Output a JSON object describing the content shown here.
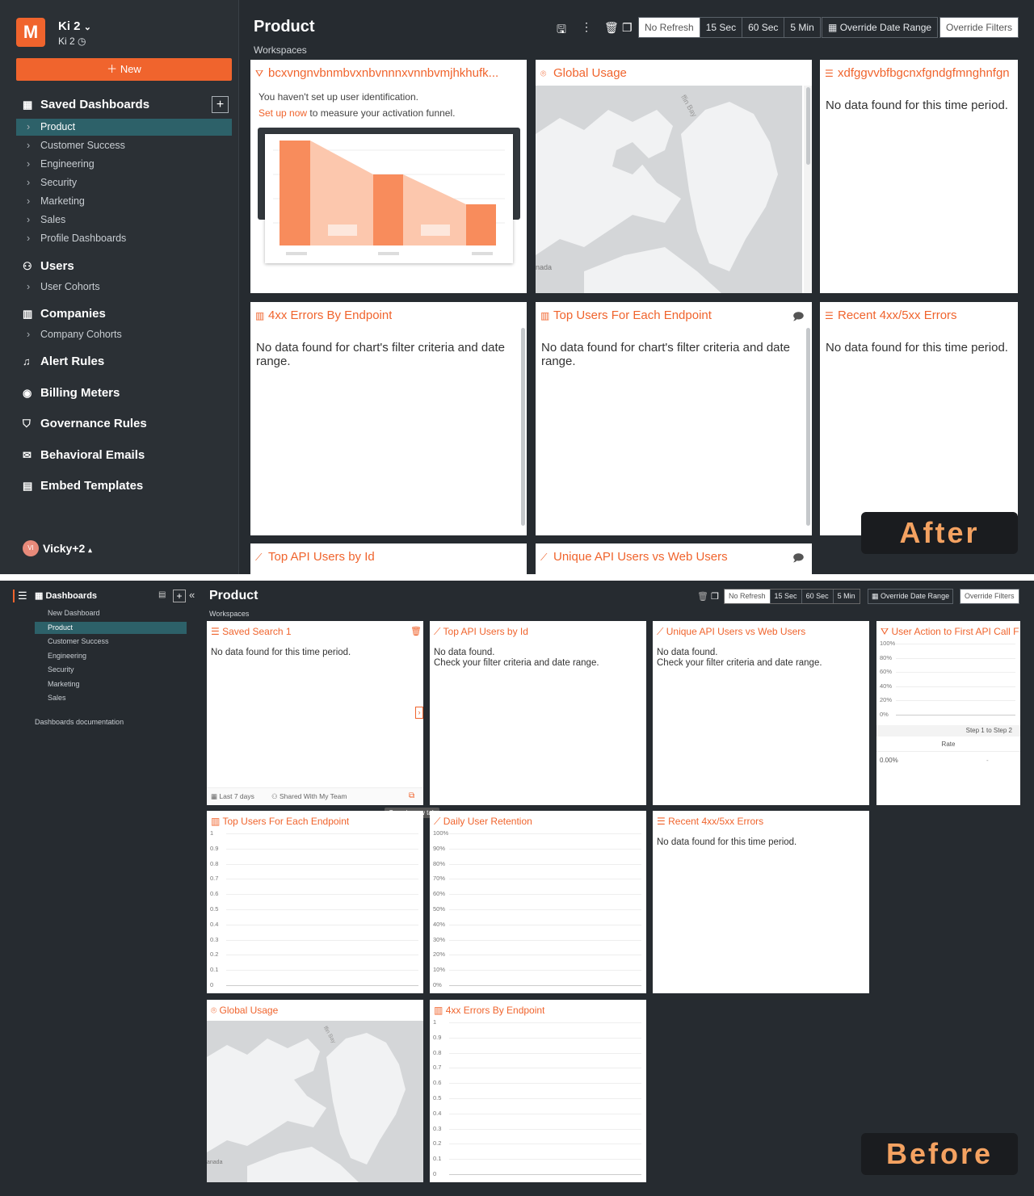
{
  "after": {
    "label": "After",
    "workspace": {
      "name": "Ki 2",
      "sub": "Ki 2"
    },
    "new_button": "New",
    "sections": {
      "saved_dashboards": "Saved Dashboards",
      "users": "Users",
      "companies": "Companies",
      "alert_rules": "Alert Rules",
      "billing_meters": "Billing Meters",
      "governance_rules": "Governance Rules",
      "behavioral_emails": "Behavioral Emails",
      "embed_templates": "Embed Templates"
    },
    "dashboards": [
      "Product",
      "Customer Success",
      "Engineering",
      "Security",
      "Marketing",
      "Sales",
      "Profile Dashboards"
    ],
    "user_items": [
      "User Cohorts"
    ],
    "company_items": [
      "Company Cohorts"
    ],
    "user_menu": {
      "avatar": "VI",
      "name": "Vicky+2"
    },
    "page_title": "Product",
    "breadcrumb": "Workspaces",
    "refresh_options": [
      "No Refresh",
      "15 Sec",
      "60 Sec",
      "5 Min"
    ],
    "override_date": "Override Date Range",
    "override_filters": "Override Filters",
    "cards": {
      "c1_title": "bcxvngnvbnmbvxnbvnnnxvnnbvmjhkhufk...",
      "c1_line1": "You haven't set up user identification.",
      "c1_link": "Set up now",
      "c1_line2": " to measure your activation funnel.",
      "c2_title": "Global Usage",
      "c2_map_label": "nada",
      "c2_bay": "ffin Bay",
      "c3_title": "xdfggvvbfbgcnxfgndgfmnghnfgn",
      "c3_msg": "No data found for this time period.",
      "c4_title": "4xx Errors By Endpoint",
      "c4_msg": "No data found for chart's filter criteria and date range.",
      "c5_title": "Top Users For Each Endpoint",
      "c5_msg": "No data found for chart's filter criteria and date range.",
      "c6_title": "Recent 4xx/5xx Errors",
      "c6_msg": "No data found for this time period.",
      "c7_title": "Top API Users by Id",
      "c8_title": "Unique API Users vs Web Users"
    }
  },
  "before": {
    "label": "Before",
    "sidebar_title": "Dashboards",
    "dashboards": [
      "New Dashboard",
      "Product",
      "Customer Success",
      "Engineering",
      "Security",
      "Marketing",
      "Sales"
    ],
    "doc_link": "Dashboards documentation",
    "page_title": "Product",
    "breadcrumb": "Workspaces",
    "refresh_options": [
      "No Refresh",
      "15 Sec",
      "60 Sec",
      "5 Min"
    ],
    "override_date": "Override Date Range",
    "override_filters": "Override Filters",
    "cards": {
      "b1_title": "Saved Search 1",
      "b1_msg": "No data found for this time period.",
      "b1_footer_range": "Last 7 days",
      "b1_footer_share": "Shared With My Team",
      "b1_tooltip": "Open in new tab",
      "b2_title": "Top API Users by Id",
      "b2_msg1": "No data found.",
      "b2_msg2": "Check your filter criteria and date range.",
      "b3_title": "Unique API Users vs Web Users",
      "b3_msg1": "No data found.",
      "b3_msg2": "Check your filter criteria and date range.",
      "b4_title": "User Action to First API Call F",
      "b4_step": "Step 1 to Step 2",
      "b4_rate_header": "Rate",
      "b4_rate": "0.00%",
      "b4_dash": "-",
      "b5_title": "Top Users For Each Endpoint",
      "b6_title": "Daily User Retention",
      "b7_title": "Recent 4xx/5xx Errors",
      "b7_msg": "No data found for this time period.",
      "b8_title": "Global Usage",
      "b8_map_label": "anada",
      "b8_bay": "ffin Bay",
      "b9_title": "4xx Errors By Endpoint"
    },
    "axes": {
      "pct_short": [
        "100%",
        "80%",
        "60%",
        "40%",
        "20%",
        "0%"
      ],
      "num": [
        "1",
        "0.9",
        "0.8",
        "0.7",
        "0.6",
        "0.5",
        "0.4",
        "0.3",
        "0.2",
        "0.1",
        "0"
      ],
      "pct_long": [
        "100%",
        "90%",
        "80%",
        "70%",
        "60%",
        "50%",
        "40%",
        "30%",
        "20%",
        "10%",
        "0%"
      ]
    }
  }
}
